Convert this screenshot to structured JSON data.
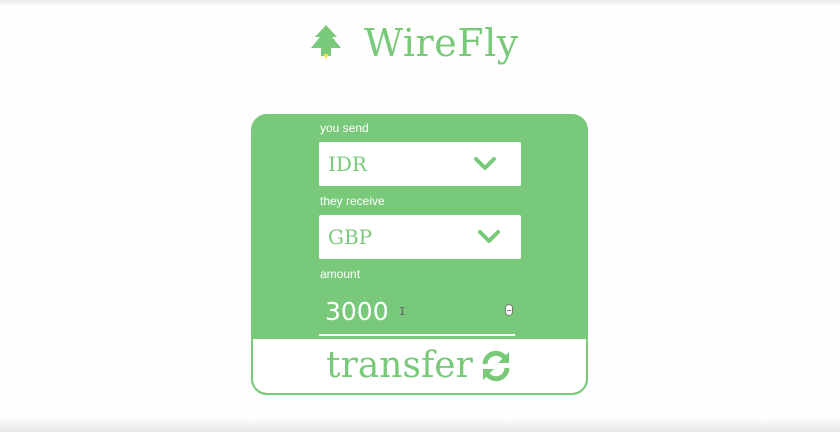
{
  "app": {
    "brand_name": "WireFly"
  },
  "form": {
    "send": {
      "label": "you send",
      "selected": "IDR"
    },
    "receive": {
      "label": "they receive",
      "selected": "GBP"
    },
    "amount": {
      "label": "amount",
      "value": "3000"
    },
    "transfer_label": "transfer"
  },
  "icons": {
    "logo": "tree-logo-icon",
    "dropdown": "chevron-down-icon",
    "transfer": "refresh-icon",
    "spinner": "number-spinner-icon"
  },
  "colors": {
    "accent": "#79c97a",
    "logo_accent": "#f2e04a",
    "surface": "#ffffff"
  }
}
